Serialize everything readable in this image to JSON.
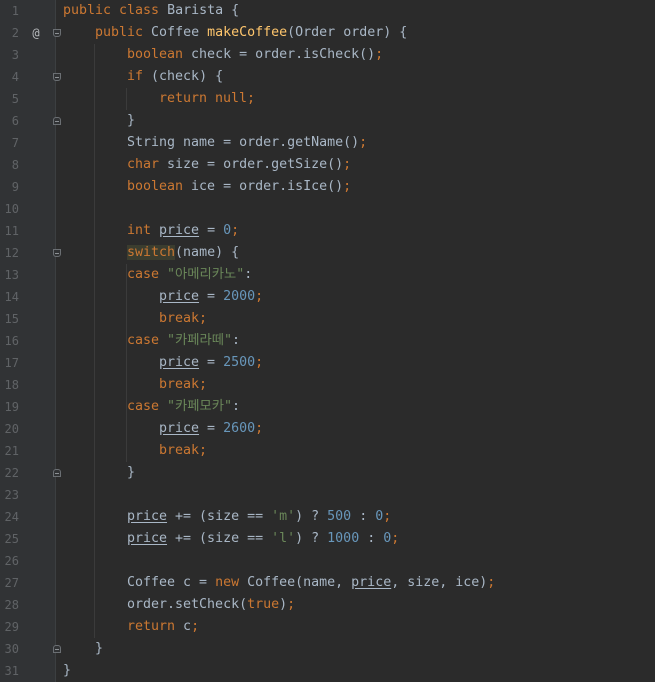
{
  "gutter": {
    "line_numbers": [
      "1",
      "2",
      "3",
      "4",
      "5",
      "6",
      "7",
      "8",
      "9",
      "10",
      "11",
      "12",
      "13",
      "14",
      "15",
      "16",
      "17",
      "18",
      "19",
      "20",
      "21",
      "22",
      "23",
      "24",
      "25",
      "26",
      "27",
      "28",
      "29",
      "30",
      "31"
    ],
    "override_marker": "@"
  },
  "code": {
    "lines": [
      {
        "indent": 0,
        "tokens": [
          {
            "t": "public class ",
            "c": "kw"
          },
          {
            "t": "Barista {",
            "c": "p"
          }
        ]
      },
      {
        "indent": 1,
        "tokens": [
          {
            "t": "public ",
            "c": "kw"
          },
          {
            "t": "Coffee ",
            "c": "p"
          },
          {
            "t": "makeCoffee",
            "c": "fn"
          },
          {
            "t": "(Order order) {",
            "c": "p"
          }
        ]
      },
      {
        "indent": 2,
        "tokens": [
          {
            "t": "boolean ",
            "c": "kw"
          },
          {
            "t": "check = order.isCheck()",
            "c": "p"
          },
          {
            "t": ";",
            "c": "kw"
          }
        ]
      },
      {
        "indent": 2,
        "tokens": [
          {
            "t": "if ",
            "c": "kw"
          },
          {
            "t": "(check) {",
            "c": "p"
          }
        ]
      },
      {
        "indent": 3,
        "tokens": [
          {
            "t": "return null;",
            "c": "kw"
          }
        ]
      },
      {
        "indent": 2,
        "tokens": [
          {
            "t": "}",
            "c": "p"
          }
        ]
      },
      {
        "indent": 2,
        "tokens": [
          {
            "t": "String name = order.getName()",
            "c": "p"
          },
          {
            "t": ";",
            "c": "kw"
          }
        ]
      },
      {
        "indent": 2,
        "tokens": [
          {
            "t": "char ",
            "c": "kw"
          },
          {
            "t": "size = order.getSize()",
            "c": "p"
          },
          {
            "t": ";",
            "c": "kw"
          }
        ]
      },
      {
        "indent": 2,
        "tokens": [
          {
            "t": "boolean ",
            "c": "kw"
          },
          {
            "t": "ice = order.isIce()",
            "c": "p"
          },
          {
            "t": ";",
            "c": "kw"
          }
        ]
      },
      {
        "indent": 0,
        "tokens": []
      },
      {
        "indent": 2,
        "tokens": [
          {
            "t": "int ",
            "c": "kw"
          },
          {
            "t": "price",
            "c": "var"
          },
          {
            "t": " = ",
            "c": "p"
          },
          {
            "t": "0",
            "c": "num"
          },
          {
            "t": ";",
            "c": "kw"
          }
        ]
      },
      {
        "indent": 2,
        "tokens": [
          {
            "t": "switch",
            "c": "kwhl"
          },
          {
            "t": "(name) {",
            "c": "p"
          }
        ]
      },
      {
        "indent": 2,
        "tokens": [
          {
            "t": "case ",
            "c": "kw"
          },
          {
            "t": "\"아메리카노\"",
            "c": "str"
          },
          {
            "t": ":",
            "c": "p"
          }
        ]
      },
      {
        "indent": 3,
        "tokens": [
          {
            "t": "price",
            "c": "var"
          },
          {
            "t": " = ",
            "c": "p"
          },
          {
            "t": "2000",
            "c": "num"
          },
          {
            "t": ";",
            "c": "kw"
          }
        ]
      },
      {
        "indent": 3,
        "tokens": [
          {
            "t": "break;",
            "c": "kw"
          }
        ]
      },
      {
        "indent": 2,
        "tokens": [
          {
            "t": "case ",
            "c": "kw"
          },
          {
            "t": "\"카페라떼\"",
            "c": "str"
          },
          {
            "t": ":",
            "c": "p"
          }
        ]
      },
      {
        "indent": 3,
        "tokens": [
          {
            "t": "price",
            "c": "var"
          },
          {
            "t": " = ",
            "c": "p"
          },
          {
            "t": "2500",
            "c": "num"
          },
          {
            "t": ";",
            "c": "kw"
          }
        ]
      },
      {
        "indent": 3,
        "tokens": [
          {
            "t": "break;",
            "c": "kw"
          }
        ]
      },
      {
        "indent": 2,
        "tokens": [
          {
            "t": "case ",
            "c": "kw"
          },
          {
            "t": "\"카페모카\"",
            "c": "str"
          },
          {
            "t": ":",
            "c": "p"
          }
        ]
      },
      {
        "indent": 3,
        "tokens": [
          {
            "t": "price",
            "c": "var"
          },
          {
            "t": " = ",
            "c": "p"
          },
          {
            "t": "2600",
            "c": "num"
          },
          {
            "t": ";",
            "c": "kw"
          }
        ]
      },
      {
        "indent": 3,
        "tokens": [
          {
            "t": "break;",
            "c": "kw"
          }
        ]
      },
      {
        "indent": 2,
        "tokens": [
          {
            "t": "}",
            "c": "p"
          }
        ]
      },
      {
        "indent": 0,
        "tokens": []
      },
      {
        "indent": 2,
        "tokens": [
          {
            "t": "price",
            "c": "var"
          },
          {
            "t": " += (size == ",
            "c": "p"
          },
          {
            "t": "'m'",
            "c": "str"
          },
          {
            "t": ") ? ",
            "c": "p"
          },
          {
            "t": "500",
            "c": "num"
          },
          {
            "t": " : ",
            "c": "p"
          },
          {
            "t": "0",
            "c": "num"
          },
          {
            "t": ";",
            "c": "kw"
          }
        ]
      },
      {
        "indent": 2,
        "tokens": [
          {
            "t": "price",
            "c": "var"
          },
          {
            "t": " += (size == ",
            "c": "p"
          },
          {
            "t": "'l'",
            "c": "str"
          },
          {
            "t": ") ? ",
            "c": "p"
          },
          {
            "t": "1000",
            "c": "num"
          },
          {
            "t": " : ",
            "c": "p"
          },
          {
            "t": "0",
            "c": "num"
          },
          {
            "t": ";",
            "c": "kw"
          }
        ]
      },
      {
        "indent": 0,
        "tokens": []
      },
      {
        "indent": 2,
        "tokens": [
          {
            "t": "Coffee c = ",
            "c": "p"
          },
          {
            "t": "new ",
            "c": "kw"
          },
          {
            "t": "Coffee(name, ",
            "c": "p"
          },
          {
            "t": "price",
            "c": "var"
          },
          {
            "t": ", size, ice)",
            "c": "p"
          },
          {
            "t": ";",
            "c": "kw"
          }
        ]
      },
      {
        "indent": 2,
        "tokens": [
          {
            "t": "order.setCheck(",
            "c": "p"
          },
          {
            "t": "true",
            "c": "kw"
          },
          {
            "t": ")",
            "c": "p"
          },
          {
            "t": ";",
            "c": "kw"
          }
        ]
      },
      {
        "indent": 2,
        "tokens": [
          {
            "t": "return ",
            "c": "kw"
          },
          {
            "t": "c",
            "c": "p"
          },
          {
            "t": ";",
            "c": "kw"
          }
        ]
      },
      {
        "indent": 1,
        "tokens": [
          {
            "t": "}",
            "c": "p"
          }
        ]
      },
      {
        "indent": 0,
        "tokens": [
          {
            "t": "}",
            "c": "p"
          }
        ]
      }
    ]
  },
  "fold_markers": [
    {
      "line": 2,
      "kind": "top"
    },
    {
      "line": 4,
      "kind": "top"
    },
    {
      "line": 6,
      "kind": "bottom"
    },
    {
      "line": 12,
      "kind": "top"
    },
    {
      "line": 22,
      "kind": "bottom"
    },
    {
      "line": 30,
      "kind": "bottom"
    }
  ],
  "colors": {
    "background": "#2b2b2b",
    "gutter": "#313335",
    "keyword": "#cc7832",
    "method": "#ffc66d",
    "number": "#6897bb",
    "string": "#6a8759",
    "plain": "#a9b7c6",
    "line_number": "#606366"
  }
}
